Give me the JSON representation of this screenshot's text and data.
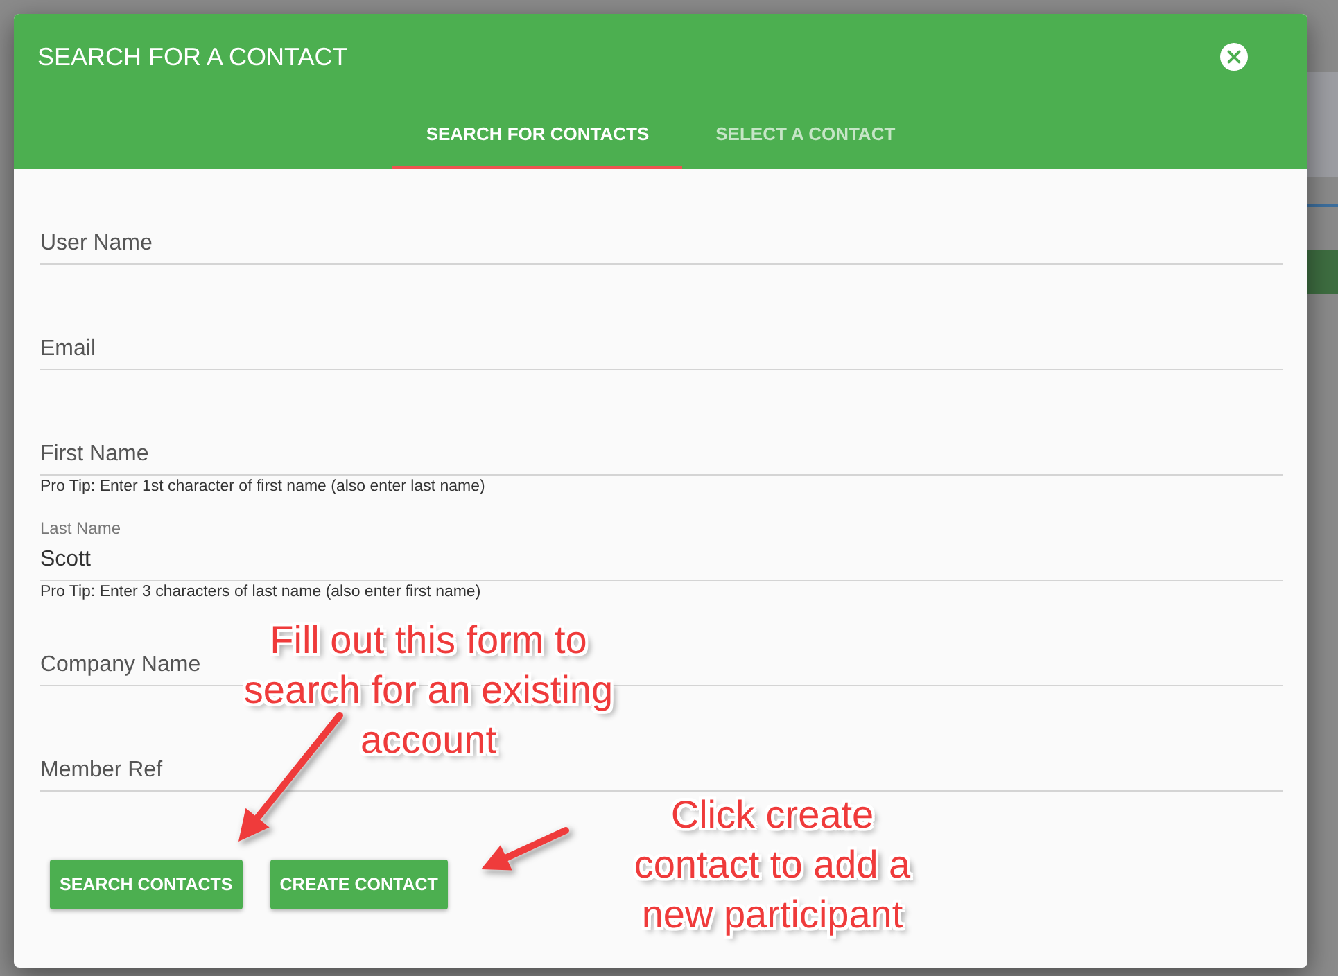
{
  "dialog": {
    "title": "SEARCH FOR A CONTACT",
    "tabs": [
      {
        "label": "SEARCH FOR CONTACTS",
        "selected": true
      },
      {
        "label": "SELECT A CONTACT",
        "selected": false
      }
    ]
  },
  "form": {
    "fields": [
      {
        "placeholder": "User Name"
      },
      {
        "placeholder": "Email"
      },
      {
        "placeholder": "First Name",
        "hint": "Pro Tip: Enter 1st character of first name (also enter last name)"
      },
      {
        "label": "Last Name",
        "value": "Scott",
        "hint": "Pro Tip: Enter 3 characters of last name (also enter first name)"
      },
      {
        "placeholder": "Company Name"
      },
      {
        "placeholder": "Member Ref"
      }
    ],
    "buttons": [
      "SEARCH CONTACTS",
      "CREATE CONTACT"
    ]
  },
  "annotations": [
    {
      "lines": [
        "Fill out this form to",
        "search for an existing",
        "account"
      ]
    },
    {
      "lines": [
        "Click create",
        "contact to add a",
        "new participant"
      ]
    }
  ]
}
